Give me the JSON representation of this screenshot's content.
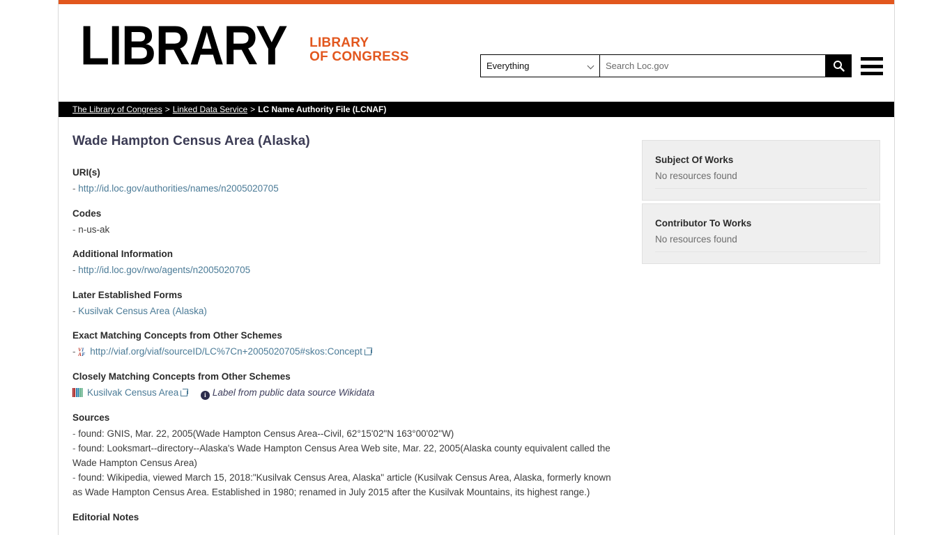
{
  "theme": {
    "accent_orange": "#e2571e",
    "link_blue": "#4b7b97",
    "title_color": "#3b3b54",
    "panel_bg": "#efefef",
    "bar_black": "#000000"
  },
  "header": {
    "logo_word": "LIBRARY",
    "logo_sub_line1": "LIBRARY",
    "logo_sub_line2": "OF CONGRESS",
    "menu_icon": "hamburger-menu-icon"
  },
  "search": {
    "scope_selected": "Everything",
    "scope_options": [
      "Everything"
    ],
    "placeholder": "Search Loc.gov",
    "value": "",
    "submit_icon": "search-icon"
  },
  "breadcrumb": {
    "items": [
      {
        "label": "The Library of Congress",
        "current": false
      },
      {
        "label": "Linked Data Service",
        "current": false
      },
      {
        "label": "LC Name Authority File (LCNAF)",
        "current": true
      }
    ],
    "separator": ">"
  },
  "main": {
    "title": "Wade Hampton Census Area (Alaska)",
    "fields": [
      {
        "label": "URI(s)",
        "type": "link-list",
        "items": [
          {
            "text": "http://id.loc.gov/authorities/names/n2005020705",
            "external": false
          }
        ]
      },
      {
        "label": "Codes",
        "type": "text-list",
        "items": [
          {
            "text": "n-us-ak"
          }
        ]
      },
      {
        "label": "Additional Information",
        "type": "link-list",
        "items": [
          {
            "text": "http://id.loc.gov/rwo/agents/n2005020705",
            "external": false
          }
        ]
      },
      {
        "label": "Later Established Forms",
        "type": "link-list",
        "items": [
          {
            "text": "Kusilvak Census Area (Alaska)",
            "external": false
          }
        ]
      },
      {
        "label": "Exact Matching Concepts from Other Schemes",
        "type": "icon-link-list",
        "items": [
          {
            "icon": "viaf-icon",
            "text": "http://viaf.org/viaf/sourceID/LC%7Cn+2005020705#skos:Concept",
            "external": true
          }
        ]
      },
      {
        "label": "Closely Matching Concepts from Other Schemes",
        "type": "icon-link-note",
        "items": [
          {
            "icon": "wikidata-icon",
            "text": "Kusilvak Census Area",
            "external": true,
            "note_icon": "info-icon",
            "note": "Label from public data source Wikidata"
          }
        ]
      },
      {
        "label": "Sources",
        "type": "paragraph-list",
        "items": [
          {
            "text": "found: GNIS, Mar. 22, 2005(Wade Hampton Census Area--Civil, 62°15'02\"N 163°00'02\"W)"
          },
          {
            "text": "found: Looksmart--directory--Alaska's Wade Hampton Census Area Web site, Mar. 22, 2005(Alaska county equivalent called the Wade Hampton Census Area)"
          },
          {
            "text": "found: Wikipedia, viewed March 15, 2018:\"Kusilvak Census Area, Alaska\" article (Kusilvak Census Area, Alaska, formerly known as Wade Hampton Census Area. Established in 1980; renamed in July 2015 after the Kusilvak Mountains, its highest range.)"
          }
        ]
      },
      {
        "label": "Editorial Notes",
        "type": "label-only",
        "items": []
      }
    ]
  },
  "sidebar": {
    "panels": [
      {
        "title": "Subject Of Works",
        "body": "No resources found"
      },
      {
        "title": "Contributor To Works",
        "body": "No resources found"
      }
    ]
  }
}
